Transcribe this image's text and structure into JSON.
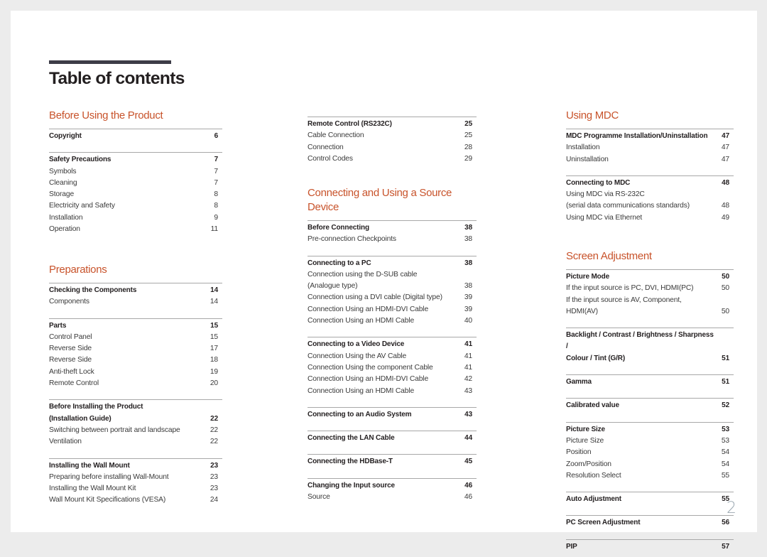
{
  "document": {
    "title": "Table of contents",
    "page_number": "2",
    "accent_color": "#c8532b"
  },
  "columns": [
    {
      "sections": [
        {
          "heading": "Before Using the Product",
          "groups": [
            {
              "title": "Copyright",
              "page": "6",
              "items": []
            },
            {
              "title": "Safety Precautions",
              "page": "7",
              "items": [
                {
                  "label": "Symbols",
                  "page": "7"
                },
                {
                  "label": "Cleaning",
                  "page": "7"
                },
                {
                  "label": "Storage",
                  "page": "8"
                },
                {
                  "label": "Electricity and Safety",
                  "page": "8"
                },
                {
                  "label": "Installation",
                  "page": "9"
                },
                {
                  "label": "Operation",
                  "page": "11"
                }
              ]
            }
          ]
        },
        {
          "heading": "Preparations",
          "groups": [
            {
              "title": "Checking the Components",
              "page": "14",
              "items": [
                {
                  "label": "Components",
                  "page": "14"
                }
              ]
            },
            {
              "title": "Parts",
              "page": "15",
              "items": [
                {
                  "label": "Control Panel",
                  "page": "15"
                },
                {
                  "label": "Reverse Side",
                  "page": "17"
                },
                {
                  "label": "Reverse Side",
                  "page": "18"
                },
                {
                  "label": "Anti-theft Lock",
                  "page": "19"
                },
                {
                  "label": "Remote Control",
                  "page": "20"
                }
              ]
            },
            {
              "title": "Before Installing the Product\n(Installation Guide)",
              "page": "22",
              "items": [
                {
                  "label": "Switching between portrait and landscape",
                  "page": "22"
                },
                {
                  "label": "Ventilation",
                  "page": "22"
                }
              ]
            },
            {
              "title": "Installing the Wall Mount",
              "page": "23",
              "items": [
                {
                  "label": "Preparing before installing Wall-Mount",
                  "page": "23"
                },
                {
                  "label": "Installing the Wall Mount Kit",
                  "page": "23"
                },
                {
                  "label": "Wall Mount Kit Specifications (VESA)",
                  "page": "24"
                }
              ]
            }
          ]
        }
      ]
    },
    {
      "sections": [
        {
          "heading": "",
          "groups": [
            {
              "title": "Remote Control (RS232C)",
              "page": "25",
              "items": [
                {
                  "label": "Cable Connection",
                  "page": "25"
                },
                {
                  "label": "Connection",
                  "page": "28"
                },
                {
                  "label": "Control Codes",
                  "page": "29"
                }
              ]
            }
          ]
        },
        {
          "heading": "Connecting and Using a Source Device",
          "groups": [
            {
              "title": "Before Connecting",
              "page": "38",
              "items": [
                {
                  "label": "Pre-connection Checkpoints",
                  "page": "38"
                }
              ]
            },
            {
              "title": "Connecting to a PC",
              "page": "38",
              "items": [
                {
                  "label": "Connection using the D-SUB cable\n(Analogue type)",
                  "page": "38"
                },
                {
                  "label": "Connection using a DVI cable (Digital type)",
                  "page": "39"
                },
                {
                  "label": "Connection Using an HDMI-DVI Cable",
                  "page": "39"
                },
                {
                  "label": "Connection Using an HDMI Cable",
                  "page": "40"
                }
              ]
            },
            {
              "title": "Connecting to a Video Device",
              "page": "41",
              "items": [
                {
                  "label": "Connection Using the AV Cable",
                  "page": "41"
                },
                {
                  "label": "Connection Using the component Cable",
                  "page": "41"
                },
                {
                  "label": "Connection Using an HDMI-DVI Cable",
                  "page": "42"
                },
                {
                  "label": "Connection Using an HDMI Cable",
                  "page": "43"
                }
              ]
            },
            {
              "title": "Connecting to an Audio System",
              "page": "43",
              "items": []
            },
            {
              "title": "Connecting the LAN Cable",
              "page": "44",
              "items": []
            },
            {
              "title": "Connecting the HDBase-T",
              "page": "45",
              "items": []
            },
            {
              "title": "Changing the Input source",
              "page": "46",
              "items": [
                {
                  "label": "Source",
                  "page": "46"
                }
              ]
            }
          ]
        }
      ]
    },
    {
      "sections": [
        {
          "heading": "Using MDC",
          "groups": [
            {
              "title": "MDC Programme Installation/Uninstallation",
              "page": "47",
              "items": [
                {
                  "label": "Installation",
                  "page": "47"
                },
                {
                  "label": "Uninstallation",
                  "page": "47"
                }
              ]
            },
            {
              "title": "Connecting to MDC",
              "page": "48",
              "items": [
                {
                  "label": "Using MDC via RS-232C\n(serial data communications standards)",
                  "page": "48"
                },
                {
                  "label": "Using MDC via Ethernet",
                  "page": "49"
                }
              ]
            }
          ]
        },
        {
          "heading": "Screen Adjustment",
          "groups": [
            {
              "title": "Picture Mode",
              "page": "50",
              "items": [
                {
                  "label": "If the input source is PC, DVI, HDMI(PC)",
                  "page": "50"
                },
                {
                  "label": "If the input source is AV, Component, HDMI(AV)",
                  "page": "50"
                }
              ]
            },
            {
              "title": "Backlight / Contrast / Brightness / Sharpness /\nColour / Tint (G/R)",
              "page": "51",
              "items": []
            },
            {
              "title": "Gamma",
              "page": "51",
              "items": []
            },
            {
              "title": "Calibrated value",
              "page": "52",
              "items": []
            },
            {
              "title": "Picture Size",
              "page": "53",
              "items": [
                {
                  "label": "Picture Size",
                  "page": "53"
                },
                {
                  "label": "Position",
                  "page": "54"
                },
                {
                  "label": "Zoom/Position",
                  "page": "54"
                },
                {
                  "label": "Resolution Select",
                  "page": "55"
                }
              ]
            },
            {
              "title": "Auto Adjustment",
              "page": "55",
              "items": []
            },
            {
              "title": "PC Screen Adjustment",
              "page": "56",
              "items": []
            },
            {
              "title": "PIP",
              "page": "57",
              "items": []
            }
          ]
        }
      ]
    }
  ]
}
